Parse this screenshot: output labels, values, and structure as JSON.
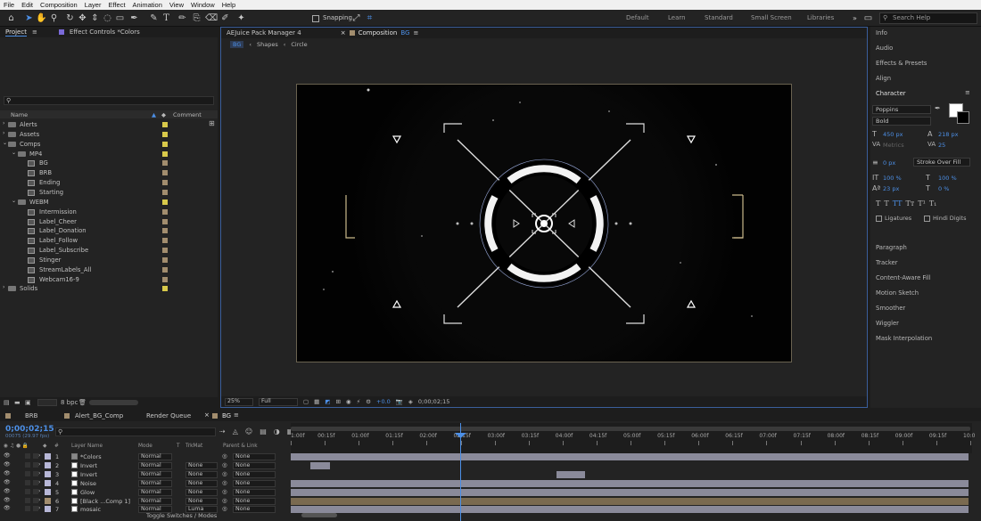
{
  "menu": [
    "File",
    "Edit",
    "Composition",
    "Layer",
    "Effect",
    "Animation",
    "View",
    "Window",
    "Help"
  ],
  "toolbar": {
    "snapping_label": "Snapping",
    "workspaces": [
      "Default",
      "Learn",
      "Standard",
      "Small Screen",
      "Libraries"
    ],
    "search_placeholder": "Search Help"
  },
  "project_panel": {
    "tab_project": "Project",
    "tab_effect_controls": "Effect Controls *Colors",
    "col_name": "Name",
    "col_comment": "Comment",
    "items": [
      {
        "type": "folder",
        "indent": 0,
        "name": "Alerts",
        "color": "yellow"
      },
      {
        "type": "folder",
        "indent": 0,
        "name": "Assets",
        "color": "yellow"
      },
      {
        "type": "folder",
        "indent": 0,
        "name": "Comps",
        "color": "yellow"
      },
      {
        "type": "folder",
        "indent": 1,
        "name": "MP4",
        "color": "yellow"
      },
      {
        "type": "comp",
        "indent": 2,
        "name": "BG",
        "color": "tan"
      },
      {
        "type": "comp",
        "indent": 2,
        "name": "BRB",
        "color": "tan"
      },
      {
        "type": "comp",
        "indent": 2,
        "name": "Ending",
        "color": "tan"
      },
      {
        "type": "comp",
        "indent": 2,
        "name": "Starting",
        "color": "tan"
      },
      {
        "type": "folder",
        "indent": 1,
        "name": "WEBM",
        "color": "yellow"
      },
      {
        "type": "comp",
        "indent": 2,
        "name": "Intermission",
        "color": "tan"
      },
      {
        "type": "comp",
        "indent": 2,
        "name": "Label_Cheer",
        "color": "tan"
      },
      {
        "type": "comp",
        "indent": 2,
        "name": "Label_Donation",
        "color": "tan"
      },
      {
        "type": "comp",
        "indent": 2,
        "name": "Label_Follow",
        "color": "tan"
      },
      {
        "type": "comp",
        "indent": 2,
        "name": "Label_Subscribe",
        "color": "tan"
      },
      {
        "type": "comp",
        "indent": 2,
        "name": "Stinger",
        "color": "tan"
      },
      {
        "type": "comp",
        "indent": 2,
        "name": "StreamLabels_All",
        "color": "tan"
      },
      {
        "type": "comp",
        "indent": 2,
        "name": "Webcam16-9",
        "color": "tan"
      },
      {
        "type": "folder",
        "indent": 0,
        "name": "Solids",
        "color": "yellow"
      }
    ],
    "bpc": "8 bpc"
  },
  "viewer": {
    "tab_aejuice": "AEJuice Pack Manager 4",
    "tab_composition": "Composition",
    "tab_comp_name": "BG",
    "breadcrumbs": [
      "BG",
      "Shapes",
      "Circle"
    ],
    "zoom": "25%",
    "resolution": "Full",
    "exposure": "+0.0",
    "timecode": "0;00;02;15"
  },
  "right_panel": {
    "sections_top": [
      "Info",
      "Audio",
      "Effects & Presets",
      "Align"
    ],
    "character_title": "Character",
    "font": "Poppins",
    "style": "Bold",
    "font_size": "450 px",
    "leading": "218 px",
    "kerning": "Metrics",
    "tracking": "25",
    "stroke_width": "0 px",
    "stroke_mode": "Stroke Over Fill",
    "vert_scale": "100 %",
    "horiz_scale": "100 %",
    "baseline": "23 px",
    "tsume": "0 %",
    "ligatures": "Ligatures",
    "hindi_digits": "Hindi Digits",
    "sections_bottom": [
      "Paragraph",
      "Tracker",
      "Content-Aware Fill",
      "Motion Sketch",
      "Smoother",
      "Wiggler",
      "Mask Interpolation"
    ]
  },
  "timeline": {
    "tabs": [
      "BRB",
      "Alert_BG_Comp",
      "Render Queue",
      "BG"
    ],
    "current_time": "0;00;02;15",
    "fps_info": "00075 (29.97 fps)",
    "col_num": "#",
    "col_layer_name": "Layer Name",
    "col_mode": "Mode",
    "col_t": "T",
    "col_trkmat": "TrkMat",
    "col_parent": "Parent & Link",
    "ruler": [
      "1:00f",
      "00:15f",
      "01:00f",
      "01:15f",
      "02:00f",
      "02:15f",
      "03:00f",
      "03:15f",
      "04:00f",
      "04:15f",
      "05:00f",
      "05:15f",
      "06:00f",
      "06:15f",
      "07:00f",
      "07:15f",
      "08:00f",
      "08:15f",
      "09:00f",
      "09:15f",
      "10:0"
    ],
    "layers": [
      {
        "num": "1",
        "name": "*Colors",
        "mode": "Normal",
        "trkmat": "",
        "parent": "None",
        "color": "#b7b7d7"
      },
      {
        "num": "2",
        "name": "Invert",
        "mode": "Normal",
        "trkmat": "None",
        "parent": "None",
        "color": "#b7b7d7"
      },
      {
        "num": "3",
        "name": "Invert",
        "mode": "Normal",
        "trkmat": "None",
        "parent": "None",
        "color": "#b7b7d7"
      },
      {
        "num": "4",
        "name": "Noise",
        "mode": "Normal",
        "trkmat": "None",
        "parent": "None",
        "color": "#b7b7d7"
      },
      {
        "num": "5",
        "name": "Glow",
        "mode": "Normal",
        "trkmat": "None",
        "parent": "None",
        "color": "#b7b7d7"
      },
      {
        "num": "6",
        "name": "[Black ...Comp 1]",
        "mode": "Normal",
        "trkmat": "None",
        "parent": "None",
        "color": "#a28d6e"
      },
      {
        "num": "7",
        "name": "mosaic",
        "mode": "Normal",
        "trkmat": "Luma",
        "parent": "None",
        "color": "#b7b7d7"
      }
    ],
    "toggle_label": "Toggle Switches / Modes"
  }
}
